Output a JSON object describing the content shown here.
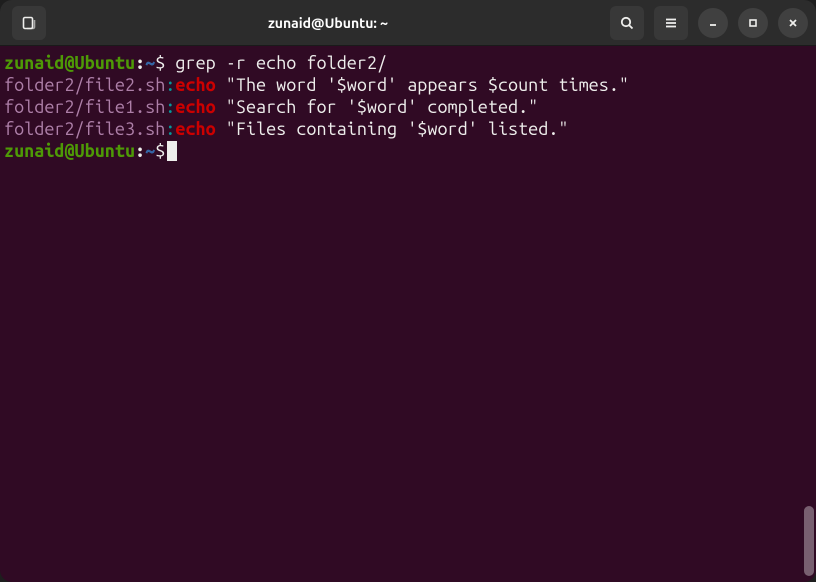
{
  "titlebar": {
    "title": "zunaid@Ubuntu: ~"
  },
  "prompt": {
    "user": "zunaid@Ubuntu",
    "sep": ":",
    "path": "~",
    "symbol": "$"
  },
  "command1": "grep -r echo folder2/",
  "output": [
    {
      "file": "folder2/file2.sh",
      "sep": ":",
      "match": "echo",
      "rest": " \"The word '$word' appears $count times.\""
    },
    {
      "file": "folder2/file1.sh",
      "sep": ":",
      "match": "echo",
      "rest": " \"Search for '$word' completed.\""
    },
    {
      "file": "folder2/file3.sh",
      "sep": ":",
      "match": "echo",
      "rest": " \"Files containing '$word' listed.\""
    }
  ]
}
